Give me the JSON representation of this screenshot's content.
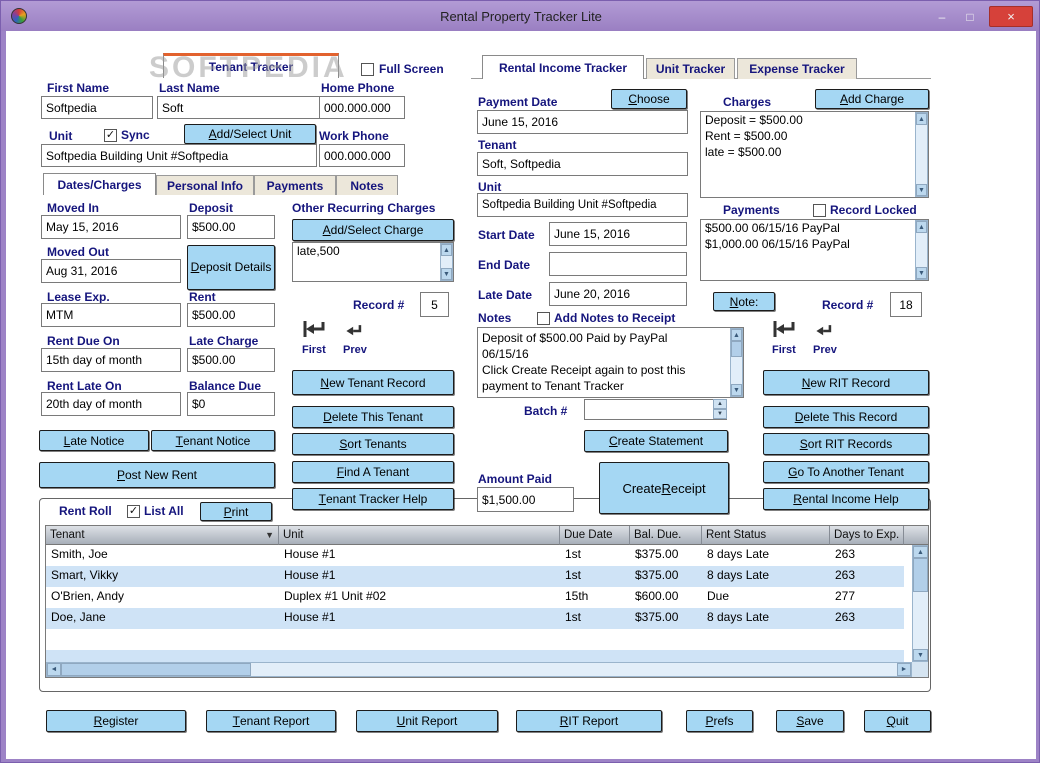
{
  "window": {
    "title": "Rental Property Tracker Lite",
    "minimize": "–",
    "maximize": "□",
    "close": "×"
  },
  "watermark": "SOFTPEDIA",
  "icons": {
    "window_icon": "colored-globe",
    "checkmark_icon": "✓",
    "sort_descending_icon": "▼",
    "scroll_up_icon": "▲",
    "scroll_down_icon": "▼",
    "scroll_left_icon": "◄",
    "scroll_right_icon": "►",
    "spinner_up_icon": "▲",
    "spinner_down_icon": "▼",
    "first_record_icon": "bent-arrow-left-with-bar",
    "previous_record_icon": "bent-arrow-left"
  },
  "colors": {
    "titlebar_purple": "#9a7fc2",
    "close_red": "#d6413a",
    "button_blue": "#a5d7f3",
    "label_navy": "#15157d",
    "row_stripe_blue": "#cfe3f6",
    "tab_accent_orange": "#e2622e"
  },
  "tenant": {
    "tab": "Tenant Tracker",
    "full_screen": "Full Screen",
    "first_name_label": "First Name",
    "first_name": "Softpedia",
    "last_name_label": "Last Name",
    "last_name": "Soft",
    "home_phone_label": "Home Phone",
    "home_phone": "000.000.000",
    "unit_label": "Unit",
    "sync": "Sync",
    "add_select_unit": "Add/Select Unit",
    "unit": "Softpedia Building Unit #Softpedia",
    "work_phone_label": "Work Phone",
    "work_phone": "000.000.000",
    "tabs": [
      "Dates/Charges",
      "Personal Info",
      "Payments",
      "Notes"
    ]
  },
  "dates": {
    "moved_in_label": "Moved In",
    "moved_in": "May 15, 2016",
    "deposit_label": "Deposit",
    "deposit": "$500.00",
    "moved_out_label": "Moved Out",
    "moved_out": "Aug 31, 2016",
    "deposit_details": "Deposit Details",
    "lease_exp_label": "Lease Exp.",
    "lease_exp": "MTM",
    "rent_label": "Rent",
    "rent": "$500.00",
    "rent_due_label": "Rent Due On",
    "rent_due": "15th day of month",
    "late_charge_label": "Late Charge",
    "late_charge": "$500.00",
    "rent_late_label": "Rent Late On",
    "rent_late": "20th day of month",
    "balance_due_label": "Balance Due",
    "balance_due": "$0",
    "late_notice": "Late Notice",
    "tenant_notice": "Tenant Notice",
    "post_new_rent": "Post New Rent"
  },
  "recurring": {
    "title": "Other Recurring Charges",
    "add_select_charge": "Add/Select Charge",
    "item": "late,500",
    "record_label": "Record #",
    "record": "5",
    "first": "First",
    "prev": "Prev",
    "new_tenant_record": "New Tenant Record",
    "delete_this_tenant": "Delete This Tenant",
    "sort_tenants": "Sort Tenants",
    "find_a_tenant": "Find A Tenant",
    "tenant_tracker_help": "Tenant Tracker Help"
  },
  "income": {
    "tabs": [
      "Rental Income Tracker",
      "Unit Tracker",
      "Expense Tracker"
    ],
    "payment_date_label": "Payment Date",
    "choose": "Choose",
    "payment_date": "June 15, 2016",
    "charges_label": "Charges",
    "add_charge": "Add Charge",
    "charges": [
      "Deposit = $500.00",
      "Rent = $500.00",
      "late = $500.00"
    ],
    "tenant_label": "Tenant",
    "tenant": "Soft, Softpedia",
    "unit_label": "Unit",
    "unit": "Softpedia Building Unit #Softpedia",
    "payments_label": "Payments",
    "record_locked": "Record Locked",
    "payments": [
      "$500.00 06/15/16 PayPal",
      "$1,000.00 06/15/16 PayPal"
    ],
    "start_date_label": "Start Date",
    "start_date": "June 15, 2016",
    "end_date_label": "End Date",
    "end_date": "",
    "late_date_label": "Late Date",
    "late_date": "June 20, 2016",
    "note_button": "Note:",
    "record_label": "Record #",
    "record": "18",
    "notes_label": "Notes",
    "add_notes_to_receipt": "Add Notes to Receipt",
    "notes_text": "Deposit of $500.00 Paid by PayPal\n06/15/16\nClick Create Receipt again to post this\npayment to Tenant Tracker",
    "first": "First",
    "prev": "Prev",
    "batch_label": "Batch #",
    "batch": "",
    "create_statement": "Create Statement",
    "amount_paid_label": "Amount Paid",
    "amount_paid": "$1,500.00",
    "create_receipt": "Create Receipt",
    "new_rit_record": "New RIT Record",
    "delete_this_record": "Delete This Record",
    "sort_rit_records": "Sort RIT Records",
    "go_to_another_tenant": "Go To Another Tenant",
    "rental_income_help": "Rental Income Help"
  },
  "rent_roll": {
    "title": "Rent Roll",
    "list_all": "List All",
    "print": "Print",
    "columns": [
      "Tenant",
      "Unit",
      "Due Date",
      "Bal. Due.",
      "Rent Status",
      "Days to Exp."
    ],
    "rows": [
      [
        "Smith, Joe",
        "House #1",
        "1st",
        "$375.00",
        "8 days Late",
        "263"
      ],
      [
        "Smart, Vikky",
        "House #1",
        "1st",
        "$375.00",
        "8 days Late",
        "263"
      ],
      [
        "O'Brien, Andy",
        "Duplex #1 Unit #02",
        "15th",
        "$600.00",
        "Due",
        "277"
      ],
      [
        "Doe, Jane",
        "House #1",
        "1st",
        "$375.00",
        "8 days Late",
        "263"
      ]
    ]
  },
  "footer": {
    "register": "Register",
    "tenant_report": "Tenant Report",
    "unit_report": "Unit Report",
    "rit_report": "RIT Report",
    "prefs": "Prefs",
    "save": "Save",
    "quit": "Quit"
  }
}
